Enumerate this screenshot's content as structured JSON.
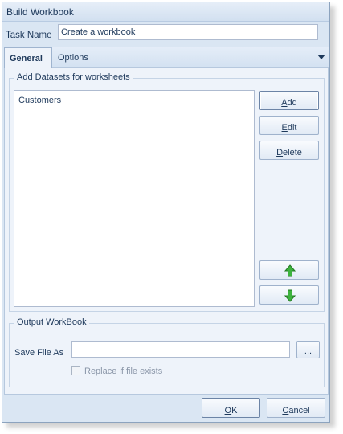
{
  "window": {
    "title": "Build Workbook"
  },
  "task": {
    "label": "Task Name",
    "value": "Create a workbook"
  },
  "tabs": [
    {
      "label": "General",
      "active": true
    },
    {
      "label": "Options",
      "active": false
    }
  ],
  "datasets": {
    "group_title": "Add Datasets for worksheets",
    "items": [
      "Customers"
    ],
    "buttons": {
      "add": {
        "label": "Add",
        "underline": "A",
        "rest": "dd"
      },
      "edit": {
        "label": "Edit",
        "underline": "E",
        "rest": "dit"
      },
      "delete": {
        "label": "Delete",
        "underline": "D",
        "rest": "elete"
      }
    },
    "move_up_icon": "green-up-arrow-icon",
    "move_down_icon": "green-down-arrow-icon"
  },
  "output": {
    "group_title": "Output WorkBook",
    "save_label": "Save File As",
    "save_value": "",
    "browse_label": "...",
    "replace_label": "Replace if file exists",
    "replace_checked": false
  },
  "footer": {
    "ok": {
      "label": "OK",
      "underline": "O",
      "rest": "K"
    },
    "cancel": {
      "label": "Cancel",
      "underline": "C",
      "rest": "ancel"
    }
  },
  "colors": {
    "accent": "#1e395b",
    "arrow": "#3db33d"
  }
}
